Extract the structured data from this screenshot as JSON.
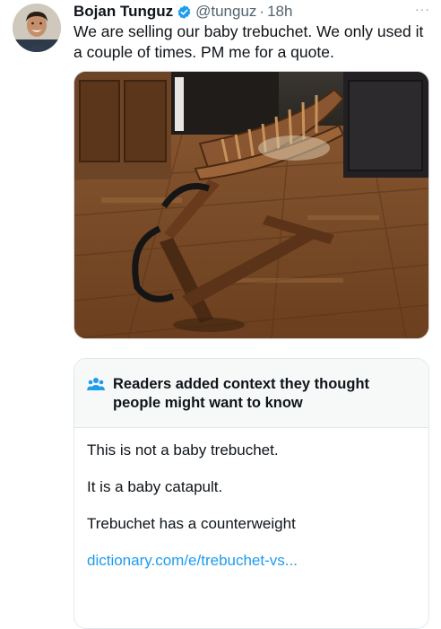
{
  "tweet": {
    "author_name": "Bojan Tunguz",
    "handle": "@tunguz",
    "separator": "·",
    "time": "18h",
    "more_label": "···",
    "text": "We are selling our baby trebuchet. We only used it a couple of times. PM me for a quote."
  },
  "community_note": {
    "title": "Readers added context they thought people might want to know",
    "lines": [
      "This is not a baby trebuchet.",
      "It is a baby catapult.",
      "Trebuchet has a counterweight"
    ],
    "link": "dictionary.com/e/trebuchet-vs..."
  },
  "colors": {
    "verified": "#1d9bf0",
    "link": "#1d9bf0",
    "muted": "#536471"
  }
}
